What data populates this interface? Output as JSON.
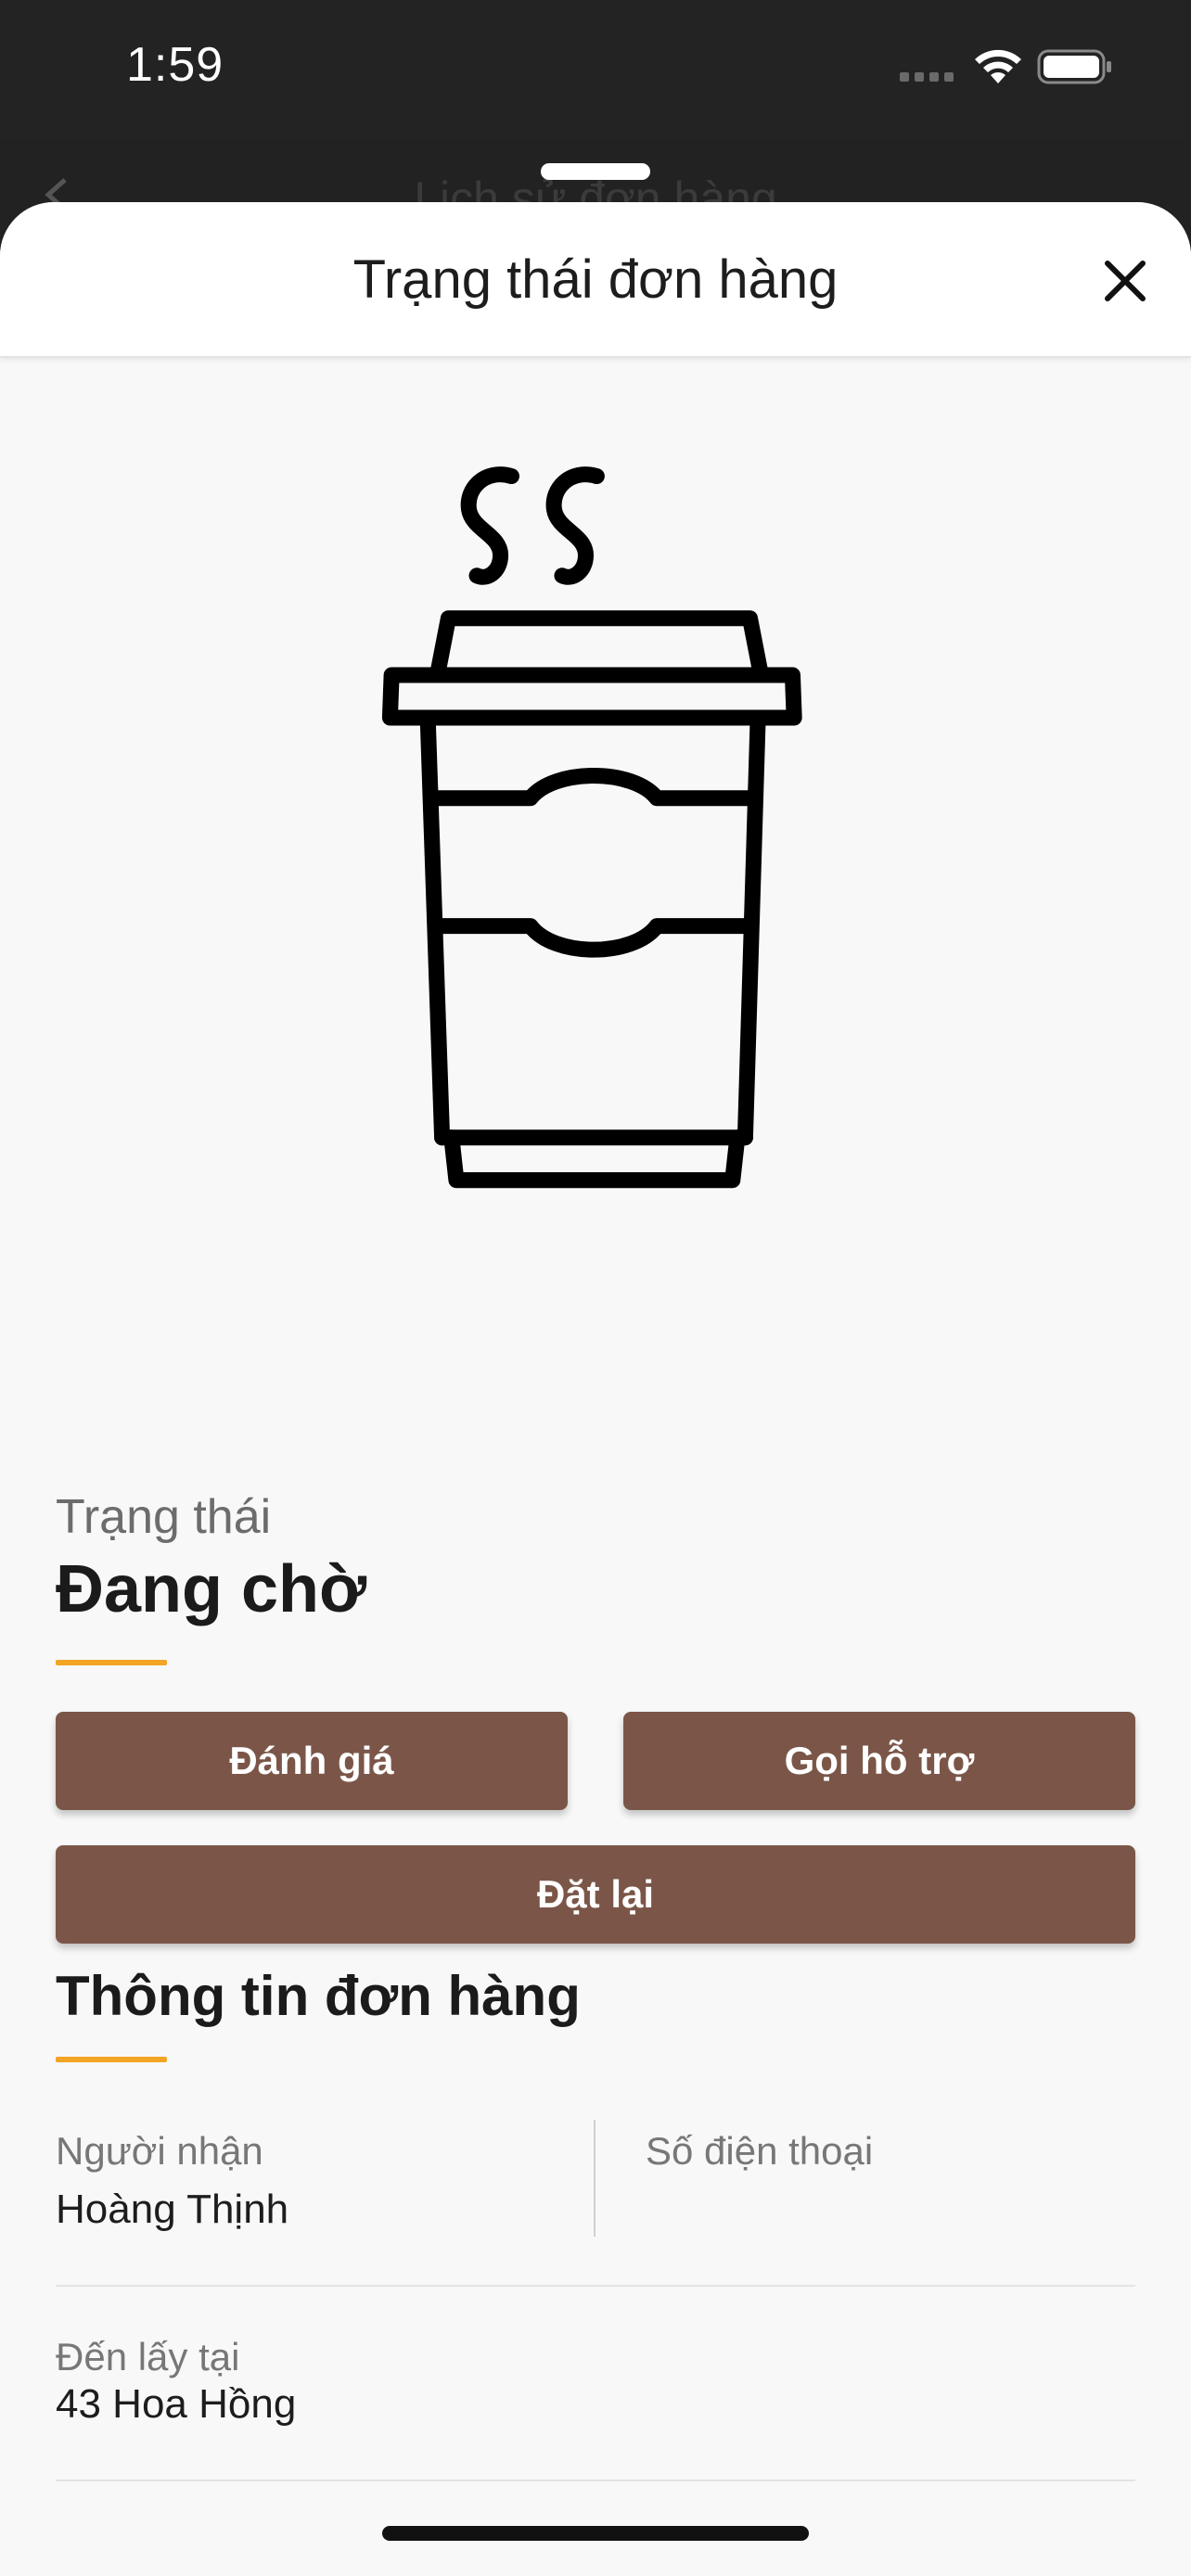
{
  "status_bar": {
    "time": "1:59"
  },
  "background_page": {
    "title": "Lịch sử đơn hàng"
  },
  "sheet": {
    "title": "Trạng thái đơn hàng",
    "close_icon": "close-icon"
  },
  "illustration": {
    "icon": "coffee-cup-icon"
  },
  "order_status": {
    "label": "Trạng thái",
    "value": "Đang chờ"
  },
  "actions": {
    "rate": "Đánh giá",
    "call_support": "Gọi hỗ trợ",
    "reorder": "Đặt lại"
  },
  "order_info": {
    "title": "Thông tin đơn hàng",
    "recipient_label": "Người nhận",
    "recipient_value": "Hoàng Thịnh",
    "phone_label": "Số điện thoại",
    "pickup_label": "Đến lấy tại",
    "pickup_value": "43 Hoa Hồng"
  },
  "colors": {
    "button": "#7b5648",
    "accent": "#f2a424",
    "status_bar": "#232323"
  }
}
